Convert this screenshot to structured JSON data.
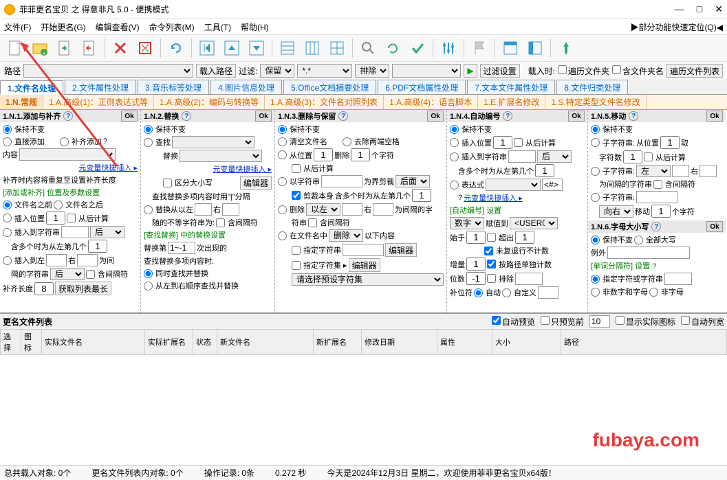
{
  "window": {
    "title": "菲菲更名宝贝 之 得意非凡 5.0 - 便携模式"
  },
  "menu": {
    "file": "文件(F)",
    "start": "开始更名(G)",
    "edit": "编辑查看(V)",
    "cmd": "命令列表(M)",
    "tools": "工具(T)",
    "help": "帮助(H)",
    "quick": "▶部分功能快速定位(Q)◀"
  },
  "path": {
    "label": "路径",
    "load": "载入路径",
    "filter": "过滤:",
    "preserve": "保留",
    "mask": "*.*",
    "sort": "排除",
    "filterset": "过滤设置",
    "loadtime": "载入时:",
    "recurse": "遍历文件夹",
    "incfolder": "含文件夹名",
    "recursebtn": "遍历文件列表"
  },
  "tabs1": [
    "1.文件名处理",
    "2.文件属性处理",
    "3.音乐标签处理",
    "4.图片信息处理",
    "5.Office文档摘要处理",
    "6.PDF文档属性处理",
    "7.文本文件属性处理",
    "8.文件归类处理"
  ],
  "tabs2": [
    "1.N.常规",
    "1.A.高级(1)：正则表达式等",
    "1.A.高级(2)：编码与转换等",
    "1.A.高级(3)：文件名对照列表",
    "1.A.高级(4)：语言脚本",
    "1.E.扩展名修改",
    "1.S.特定类型文件名修改"
  ],
  "p1": {
    "title": "1.N.1.添加与补齐",
    "ok": "Ok",
    "keep": "保持不变",
    "direct": "直接添加",
    "pad": "补齐添加",
    "content": "内容",
    "varlink": "元变量快捷插入 ▸",
    "tip": "补齐时内容将重复至设置补齐长度",
    "group": "[添加或补齐] 位置及参数设置",
    "before": "文件名之前",
    "after": "文件名之后",
    "inspos": "插入位置",
    "fromback": "从后计算",
    "insstr": "插入到字符串",
    "hou": "后",
    "multi": "含多个时为从左第几个",
    "insleft": "插入到左",
    "right": "右",
    "between": "为间",
    "sepstr": "隔的字符串",
    "incsep": "含间隔符",
    "padlen": "补齐长度",
    "getmax": "获取列表最长",
    "num1": "1",
    "num8": "8"
  },
  "p2": {
    "title": "1.N.2.替换",
    "ok": "Ok",
    "keep": "保持不变",
    "find": "查找",
    "replace": "替换",
    "varlink": "元变量快捷插入 ▸",
    "case": "区分大小写",
    "editor": "编辑器",
    "multitip": "查找替换多项内容时用\"|\"分隔",
    "replfrom": "替换从以左",
    "right": "右",
    "noneq": "随的不等字符串为:",
    "incsep": "含间隔符",
    "group": "[查找替换] 中的替换设置",
    "nth": "替换第",
    "times": "次出现的",
    "all": "查找替换多项内容时:",
    "same": "同时查找并替换",
    "seq": "从左到右顺序查找并替换",
    "range": "1~-1"
  },
  "p3": {
    "title": "1.N.3.删除与保留",
    "ok": "Ok",
    "keep": "保持不变",
    "clear": "清空文件名",
    "trimspace": "去除两端空格",
    "frompos": "从位置",
    "del": "删除",
    "chars": "个字符",
    "fromback": "从后计算",
    "bystr": "以字符串",
    "bound": "为界剪裁",
    "houmian": "后面",
    "cutself": "剪裁本身",
    "multipos": "含多个时为从左第几个",
    "delete": "删除",
    "left": "以左",
    "right": "右",
    "between": "为间隔的字",
    "str": "符串",
    "incsep": "含间隔符",
    "infilename": "在文件名中",
    "delsel": "删除",
    "below": "以下内容",
    "speccharset": "指定字符串",
    "editor": "编辑器",
    "speccharset2": "指定字符集 ▸",
    "editor2": "编辑器",
    "presettip": "请选择预设字符集",
    "num1": "1"
  },
  "p4": {
    "title": "1.N.4.自动编号",
    "ok": "Ok",
    "keep": "保持不变",
    "inspos": "插入位置",
    "fromback": "从后计算",
    "insstr": "插入到字符串",
    "hou": "后",
    "multipos": "含多个时为从左第几个",
    "expr": "表达式",
    "expreg": "<#>",
    "varlink": "元变量快捷插入 ▸",
    "group": "[自动编号] 设置",
    "numword": "数字",
    "assignto": "赋值到",
    "user0": "<USER0>",
    "start": "始于",
    "exceed": "超出",
    "norepeat": "未复退行不计数",
    "incr": "增量",
    "byroute": "按路径单独计数",
    "digits": "位数",
    "exclude": "排除",
    "fillchar": "补位符",
    "auto": "自动",
    "custom": "自定义",
    "num1": "1",
    "numn1": "-1"
  },
  "p5": {
    "title": "1.N.5.移动",
    "ok": "Ok",
    "keep": "保持不变",
    "substr": "子字符串:",
    "frompos": "从位置",
    "take": "取",
    "charnum": "字符数",
    "fromback": "从后计算",
    "substr2": "子字符串:",
    "left": "左",
    "right": "右",
    "between": "为间隔的字符串",
    "incsep": "含间隔符",
    "substr3": "子字符串:",
    "toright": "向右",
    "move": "移动",
    "chars": "个字符",
    "num1": "1",
    "title2": "1.N.6.字母大小写",
    "ok2": "Ok",
    "keep2": "保持不变",
    "allupper": "全部大写",
    "except": "例外",
    "group": "[单词分隔符] 设置",
    "speccharset": "指定字符或字符串",
    "nondigit": "非数字和字母",
    "nonletter": "非字母"
  },
  "list": {
    "title": "更名文件列表",
    "autopreview": "自动预览",
    "onlypreview": "只预览前",
    "previewnum": "10",
    "showicon": "显示实际图标",
    "autolist": "自动列宽",
    "cols": [
      "选择",
      "图标",
      "实际文件名",
      "实际扩展名",
      "状态",
      "新文件名",
      "新扩展名",
      "修改日期",
      "属性",
      "大小",
      "路径"
    ]
  },
  "status": {
    "total": "总共载入对象: 0个",
    "inlist": "更名文件列表内对象: 0个",
    "ops": "操作记录: 0条",
    "time": "0.272 秒",
    "msg": "今天是2024年12月3日 星期二，欢迎使用菲菲更名宝贝x64版！"
  },
  "watermark": "fubaya.com"
}
